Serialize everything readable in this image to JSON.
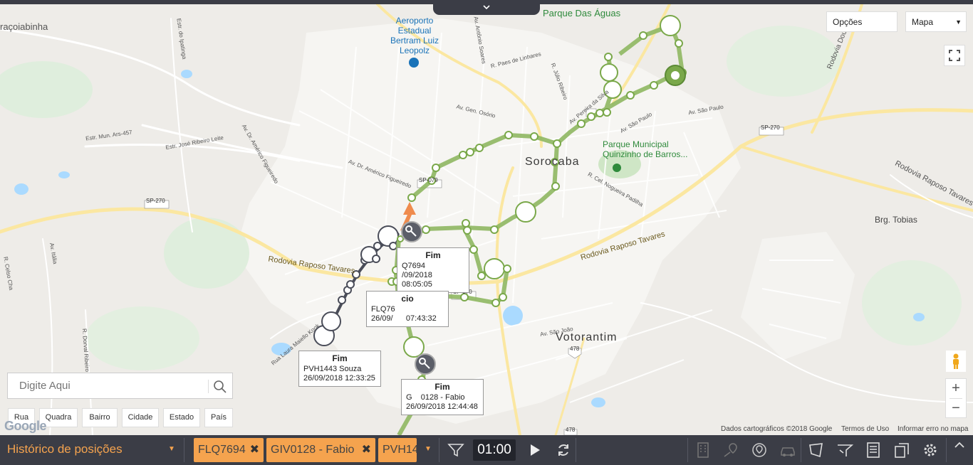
{
  "top_panel": {
    "collapse_icon": "chevron-down-icon"
  },
  "map": {
    "labels": {
      "aracoiabinha": "raçoiabinha",
      "airport": "Aeroporto\nEstadual\nBertram Luiz\nLeopolz",
      "parque_aguas": "Parque Das Águas",
      "sorocaba": "Sorocaba",
      "parque_municipal": "Parque Municipal\nQuinzinho de Barros...",
      "brg_tobias": "Brg. Tobias",
      "votorantim": "Votorantim",
      "raposo_1": "Rodovia Raposo Tavares",
      "raposo_2": "Rodovia Raposo Tavares",
      "raposo_3": "Rodovia Raposo Tavares",
      "doutor": "Rodovia Doutor Co",
      "sp270_a": "SP-270",
      "sp270_b": "SP-270",
      "sp079": "SP-079",
      "sp270_c": "SP-270",
      "r478_a": "478",
      "r478_b": "478",
      "estr_ipatinga": "Estr. do Ipatinga",
      "estr_mun": "Estr. Mun. Ars-457",
      "estr_jose": "Estr. José Ribeiro Leite",
      "av_americo": "Av. Dr. Américo Figueiredo",
      "av_americo2": "Av. Dr. Américo Figueiredo",
      "av_gen": "Av. Gen. Osório",
      "av_sao_paulo": "Av. São Paulo",
      "av_sao_paulo2": "Av. São Paulo",
      "av_sao_joao": "Av. São João",
      "r_julio": "R. Júlio Ribeiro",
      "r_paes": "R. Paes de Linhares",
      "av_pereira": "Av. Pereira da Silva",
      "r_cel": "R. Cel. Nogueira Padilha",
      "r_laura": "Rua Laura Maiello Kook",
      "av_italia": "Av. Itália",
      "r_dorval": "R. Dorval Ribeiro",
      "r_celso": "R. Celso Cha",
      "av_antonio": "Av. Antônio Soares"
    },
    "route_colors": {
      "green": "#7aa84a",
      "dark": "#4a4d59",
      "orange": "#ee7f3b"
    }
  },
  "controls": {
    "options_label": "Opções",
    "map_type_label": "Mapa",
    "map_type_caret_icon": "chevron-down-icon",
    "fullscreen_icon": "fullscreen-icon",
    "pegman_icon": "pegman-icon",
    "zoom_in": "+",
    "zoom_out": "−"
  },
  "search": {
    "placeholder": "Digite Aqui",
    "icon": "search-icon"
  },
  "filters": [
    "Rua",
    "Quadra",
    "Bairro",
    "Cidade",
    "Estado",
    "País"
  ],
  "tooltips": [
    {
      "title": "Fim",
      "line1": "PVH1443 Souza",
      "line2": "26/09/2018 12:33:25"
    },
    {
      "title": "Fim",
      "line1": "Q7694",
      "line2": "/09/2018 08:05:05"
    },
    {
      "title": "cio",
      "line1": "FLQ76",
      "line2": "26/09/      07:43:32"
    },
    {
      "title": "Fim",
      "line1": "G    0128 - Fabio",
      "line2": "26/09/2018 12:44:48"
    }
  ],
  "attribution": {
    "logo": "Google",
    "data": "Dados cartográficos ©2018 Google",
    "terms": "Termos de Uso",
    "report": "Informar erro no mapa"
  },
  "bottom_bar": {
    "history_label": "Histórico de posições",
    "history_caret_icon": "chevron-down-icon",
    "chips": [
      {
        "label": "FLQ7694",
        "remove": "✖"
      },
      {
        "label": "GIV0128 - Fabio",
        "remove": "✖"
      },
      {
        "label": "PVH14"
      }
    ],
    "chips_caret_icon": "chevron-down-icon",
    "filter_icon": "filter-icon",
    "time": "01:00",
    "play_icon": "play-icon",
    "refresh_icon": "refresh-icon",
    "tool_icons": [
      "building-icon",
      "location-history-icon",
      "fence-icon",
      "vehicle-icon",
      "polygon-icon",
      "route-icon",
      "report-icon",
      "reports-icon",
      "settings-icon",
      "chevron-up-icon"
    ]
  },
  "colors": {
    "accent": "#f5a34e",
    "bar": "#3b3d46"
  }
}
